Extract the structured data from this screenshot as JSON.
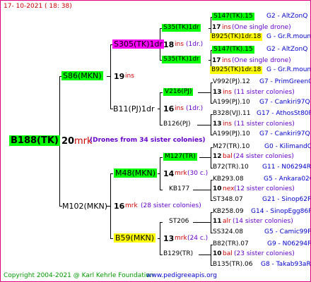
{
  "header": {
    "date": "17- 10-2021 ( 18: 38)"
  },
  "footer": {
    "copyright": "Copyright 2004-2021 @ Karl Kehrle Foundation",
    "site": "www.pedigreeapis.org"
  },
  "colors": {
    "frame": "#e0007f",
    "green_box": "#00ff00",
    "magenta_box": "#ff00ff",
    "yellow_box": "#ffff00",
    "red_text": "#cc0000",
    "blue_text": "#0000cc",
    "purple_text": "#6600cc",
    "dark_green_text": "#009900"
  },
  "tree": {
    "root": {
      "id": "B188(TK)",
      "num": "20",
      "label": "mrk",
      "note": "(Drones from 34 sister colonies)"
    },
    "s86": {
      "id": "S86(MKN)",
      "num": "19",
      "label": "ins"
    },
    "m102": {
      "id": "M102(MKN)",
      "num": "16",
      "label": "mrk",
      "note": "(28 sister colonies)"
    },
    "s305": {
      "id": "S305(TK)1dr",
      "num": "18",
      "label": "ins",
      "note": "(1dr.)"
    },
    "b11": {
      "id": "B11(PJ)1dr",
      "num": "16",
      "label": "ins",
      "note": "(1dr.)"
    },
    "m48": {
      "id": "M48(MKN)",
      "num": "14",
      "label": "mrk",
      "note": "(30 c.)"
    },
    "b59": {
      "id": "B59(MKN)",
      "num": "13",
      "label": "mrk",
      "note": "(24 c.)"
    },
    "s35a": {
      "id": "S35(TK)1dr",
      "num": "17",
      "label": "ins",
      "note": "(One single drone)",
      "q": "S147(TK).15",
      "q_note": "G2 - AltZonQ",
      "d": "B925(TK)1dr.18",
      "d_note": "G - Gr.R.mounta"
    },
    "s35b": {
      "id": "S35(TK)1dr",
      "num": "17",
      "label": "ins",
      "note": "(One single drone)",
      "q": "S147(TK).15",
      "q_note": "G2 - AltZonQ",
      "d": "B925(TK)1dr.18",
      "d_note": "G - Gr.R.mounta"
    },
    "v216": {
      "id": "V216(PJ)",
      "num": "13",
      "label": "ins",
      "note": "(11 sister colonies)",
      "q": "V992(PJ).12",
      "q_note": "G7 - PrimGreen00",
      "d": "A199(PJ).10",
      "d_note": "G7 - Cankiri97Q"
    },
    "b126": {
      "id": "B126(PJ)",
      "num": "13",
      "label": "ins",
      "note": "(11 sister colonies)",
      "q": "B328(VJ).11",
      "q_note": "G17 - AthosSt80R",
      "d": "A199(PJ).10",
      "d_note": "G7 - Cankiri97Q"
    },
    "m127": {
      "id": "M127(TR)",
      "num": "12",
      "label": "bal",
      "note": "(24 sister colonies)",
      "q": "M27(TR).10",
      "q_note": "G0 - KilimandQ",
      "d": "B72(TR).10",
      "d_note": "G11 - N06294R"
    },
    "kb177": {
      "id": "KB177",
      "num": "10",
      "label": "nex",
      "note": "(12 sister colonies)",
      "q": "KB293.08",
      "q_note": "G5 - Ankara02Q",
      "d": "ST348.07",
      "d_note": "G21 - Sinop62R"
    },
    "st206": {
      "id": "ST206",
      "num": "11",
      "label": "alr",
      "note": "(14 sister colonies)",
      "q": "KB258.09",
      "q_note": "G14 - SinopEgg86R",
      "d": "SS324.08",
      "d_note": "G5 - Camic99R"
    },
    "b129": {
      "id": "B129(TR)",
      "num": "10",
      "label": "bal",
      "note": "(23 sister colonies)",
      "q": "B82(TR).07",
      "q_note": "G9 - N06294R",
      "d": "B135(TR).06",
      "d_note": "G8 - Takab93aR"
    }
  }
}
